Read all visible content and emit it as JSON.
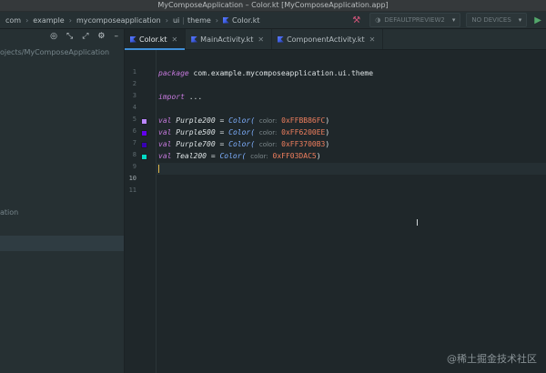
{
  "window": {
    "title": "MyComposeApplication – Color.kt [MyComposeApplication.app]"
  },
  "breadcrumbs": [
    "com",
    "example",
    "mycomposeapplication",
    "ui",
    "theme",
    "Color.kt"
  ],
  "toolbar": {
    "preview_combo": "DEFAULTPREVIEW2",
    "devices_combo": "NO DEVICES",
    "icons": [
      "hammer-icon",
      "settings-icon",
      "run-icon"
    ]
  },
  "sidebar": {
    "toolbar_icons": [
      "target-icon",
      "collapse-icon",
      "expand-icon",
      "gear-icon",
      "minimize-icon"
    ],
    "path_text": "ojects/MyComposeApplication",
    "item_text": "ation"
  },
  "tabs": [
    {
      "label": "Color.kt",
      "active": true
    },
    {
      "label": "MainActivity.kt",
      "active": false
    },
    {
      "label": "ComponentActivity.kt",
      "active": false
    }
  ],
  "editor": {
    "line_numbers": [
      "1",
      "2",
      "3",
      "4",
      "5",
      "6",
      "7",
      "8",
      "9",
      "10",
      "11"
    ],
    "current_line": "10",
    "package_kw": "package",
    "package_name": "com.example.mycomposeapplication.ui.theme",
    "import_kw": "import",
    "import_rest": "...",
    "colors": [
      {
        "name": "Purple200",
        "hex": "0xFFBB86FC",
        "swatch": "#BB86FC"
      },
      {
        "name": "Purple500",
        "hex": "0xFF6200EE",
        "swatch": "#6200EE"
      },
      {
        "name": "Purple700",
        "hex": "0xFF3700B3",
        "swatch": "#3700B3"
      },
      {
        "name": "Teal200",
        "hex": "0xFF03DAC5",
        "swatch": "#03DAC5"
      }
    ],
    "val_kw": "val",
    "eq": "=",
    "color_fn": "Color(",
    "param_hint": "color:",
    "close_paren": ")"
  },
  "watermark": "@稀土掘金技术社区"
}
